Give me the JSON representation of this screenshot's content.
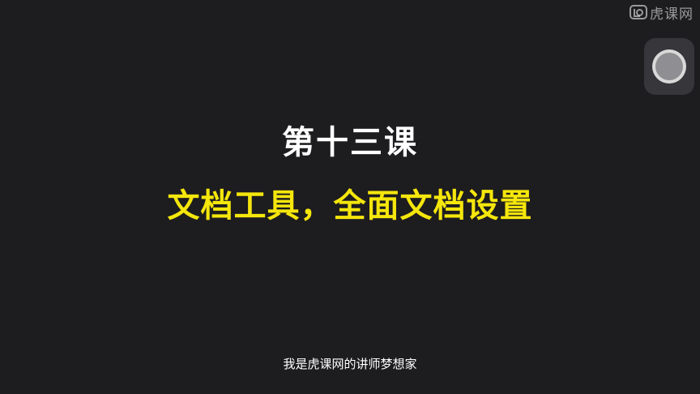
{
  "watermark": {
    "brand_icon": "huke-logo-icon",
    "text": "虎课网"
  },
  "floating_button": {
    "icon": "assistive-touch-icon"
  },
  "slide": {
    "title": "第十三课",
    "subtitle": "文档工具，全面文档设置"
  },
  "subtitle_caption": {
    "text": "我是虎课网的讲师梦想家"
  },
  "colors": {
    "background": "#1d1c1f",
    "title": "#ffffff",
    "subtitle": "#f5e60c",
    "float_button_bg": "#37363b"
  }
}
